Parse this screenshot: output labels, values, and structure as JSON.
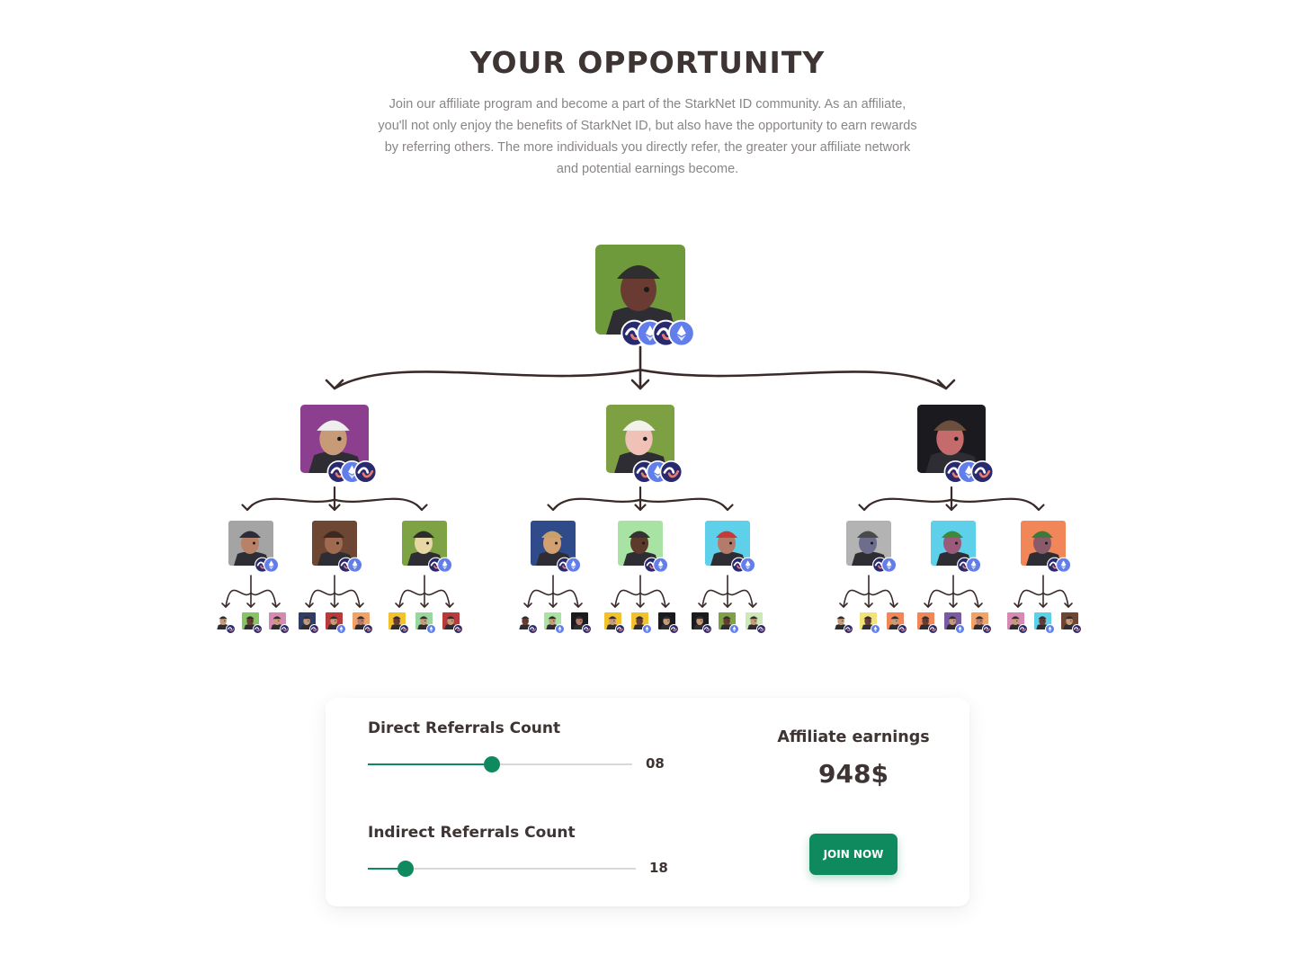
{
  "header": {
    "title": "YOUR OPPORTUNITY",
    "description": "Join our affiliate program and become a part of the StarkNet ID community. As an affiliate, you'll not only enjoy the benefits of StarkNet ID, but also have the opportunity to earn rewards by referring others. The more individuals you directly refer, the greater your affiliate network and potential earnings become."
  },
  "tree": {
    "root": {
      "bg": "#6f9a3c",
      "skin": "#6a3b32",
      "hat": "#2f2f2f",
      "badges": [
        "starknet",
        "ethereum",
        "starknet",
        "ethereum"
      ]
    },
    "level1": [
      {
        "bg": "#8d3f8f",
        "skin": "#c79a78",
        "hat": "#eeeeee",
        "badges": [
          "starknet",
          "ethereum",
          "starknet"
        ]
      },
      {
        "bg": "#7da043",
        "skin": "#f0c1b7",
        "hat": "#f2f2ea",
        "badges": [
          "starknet",
          "ethereum",
          "starknet"
        ]
      },
      {
        "bg": "#1b1b1f",
        "skin": "#c66b6b",
        "hat": "#6b4e3d",
        "badges": [
          "starknet",
          "ethereum",
          "starknet"
        ]
      }
    ],
    "level2": [
      {
        "bg": "#a4a4a4",
        "skin": "#b88269",
        "hat": "#2c2c3a",
        "badges": [
          "starknet",
          "ethereum"
        ]
      },
      {
        "bg": "#6e4634",
        "skin": "#a06a50",
        "hat": "#3a2a22",
        "badges": [
          "starknet",
          "ethereum"
        ]
      },
      {
        "bg": "#7ea344",
        "skin": "#e8d7a5",
        "hat": "#2d2d2d",
        "badges": [
          "starknet",
          "ethereum"
        ]
      },
      {
        "bg": "#2f4b8a",
        "skin": "#d3a072",
        "hat": "#c7a16a",
        "badges": [
          "starknet",
          "ethereum"
        ]
      },
      {
        "bg": "#a8e3a3",
        "skin": "#5d3a2c",
        "hat": "#333333",
        "badges": [
          "starknet",
          "ethereum"
        ]
      },
      {
        "bg": "#5fd0ea",
        "skin": "#b57b6a",
        "hat": "#c63a3a",
        "badges": [
          "starknet",
          "ethereum"
        ]
      },
      {
        "bg": "#b3b3b3",
        "skin": "#6d6d8d",
        "hat": "#4a4a4a",
        "badges": [
          "starknet",
          "ethereum"
        ]
      },
      {
        "bg": "#5fd0ea",
        "skin": "#9b5a7a",
        "hat": "#3d8a3a",
        "badges": [
          "starknet",
          "ethereum"
        ]
      },
      {
        "bg": "#f18758",
        "skin": "#8a5a6a",
        "hat": "#3d7a3a",
        "badges": [
          "starknet",
          "ethereum"
        ]
      }
    ],
    "level3": [
      {
        "bg": "#ffffff",
        "skin": "#c79a78",
        "hat": "#2f2f2f",
        "badges": [
          "starknet"
        ]
      },
      {
        "bg": "#87c464",
        "skin": "#6a3b32",
        "hat": "#2f2f2f",
        "badges": [
          "starknet"
        ]
      },
      {
        "bg": "#d889b3",
        "skin": "#c79a78",
        "hat": "#2f2f2f",
        "badges": [
          "starknet"
        ]
      },
      {
        "bg": "#2f3d66",
        "skin": "#c79a78",
        "hat": "#2f2f2f",
        "badges": [
          "starknet"
        ]
      },
      {
        "bg": "#b83a3a",
        "skin": "#c79a78",
        "hat": "#2f2f2f",
        "badges": [
          "ethereum"
        ]
      },
      {
        "bg": "#f0a268",
        "skin": "#b57b6a",
        "hat": "#2f2f2f",
        "badges": [
          "starknet"
        ]
      },
      {
        "bg": "#f2c12e",
        "skin": "#6a3b32",
        "hat": "#2f2f2f",
        "badges": [
          "starknet"
        ]
      },
      {
        "bg": "#9ad69f",
        "skin": "#c79a78",
        "hat": "#2f2f2f",
        "badges": [
          "ethereum"
        ]
      },
      {
        "bg": "#b83a3a",
        "skin": "#c79a78",
        "hat": "#2f2f2f",
        "badges": [
          "starknet"
        ]
      },
      {
        "bg": "#ffffff",
        "skin": "#6a3b32",
        "hat": "#2f2f2f",
        "badges": [
          "starknet"
        ]
      },
      {
        "bg": "#a8e3a3",
        "skin": "#c79a78",
        "hat": "#2f2f2f",
        "badges": [
          "ethereum"
        ]
      },
      {
        "bg": "#1b1b1f",
        "skin": "#b57b6a",
        "hat": "#2f2f2f",
        "badges": [
          "starknet"
        ]
      },
      {
        "bg": "#f2c12e",
        "skin": "#c79a78",
        "hat": "#2f2f2f",
        "badges": [
          "starknet"
        ]
      },
      {
        "bg": "#f2c12e",
        "skin": "#6a3b32",
        "hat": "#2f2f2f",
        "badges": [
          "ethereum"
        ]
      },
      {
        "bg": "#1b1b1f",
        "skin": "#c79a78",
        "hat": "#2f2f2f",
        "badges": [
          "starknet"
        ]
      },
      {
        "bg": "#1b1b1f",
        "skin": "#c79a78",
        "hat": "#2f2f2f",
        "badges": [
          "starknet"
        ]
      },
      {
        "bg": "#7ea344",
        "skin": "#6a3b32",
        "hat": "#2f2f2f",
        "badges": [
          "ethereum"
        ]
      },
      {
        "bg": "#cfe8b8",
        "skin": "#c79a78",
        "hat": "#2f2f2f",
        "badges": [
          "starknet"
        ]
      },
      {
        "bg": "#ffffff",
        "skin": "#c79a78",
        "hat": "#2f2f2f",
        "badges": [
          "starknet"
        ]
      },
      {
        "bg": "#f2e27a",
        "skin": "#6a3b32",
        "hat": "#2f2f2f",
        "badges": [
          "ethereum"
        ]
      },
      {
        "bg": "#f18758",
        "skin": "#c79a78",
        "hat": "#2f2f2f",
        "badges": [
          "starknet"
        ]
      },
      {
        "bg": "#f18758",
        "skin": "#6a3b32",
        "hat": "#2f2f2f",
        "badges": [
          "starknet"
        ]
      },
      {
        "bg": "#7a5aa3",
        "skin": "#c79a78",
        "hat": "#2f2f2f",
        "badges": [
          "ethereum"
        ]
      },
      {
        "bg": "#f0a268",
        "skin": "#b57b6a",
        "hat": "#2f2f2f",
        "badges": [
          "starknet"
        ]
      },
      {
        "bg": "#d889b3",
        "skin": "#c79a78",
        "hat": "#2f2f2f",
        "badges": [
          "starknet"
        ]
      },
      {
        "bg": "#5fd0ea",
        "skin": "#6a3b32",
        "hat": "#2f2f2f",
        "badges": [
          "ethereum"
        ]
      },
      {
        "bg": "#6e4634",
        "skin": "#c79a78",
        "hat": "#2f2f2f",
        "badges": [
          "starknet"
        ]
      }
    ],
    "colors": {
      "arrow": "#3b2a2a",
      "starknet": "#29296e",
      "starknet_red": "#ec796b",
      "ethereum": "#627eea"
    }
  },
  "calculator": {
    "direct": {
      "label": "Direct Referrals Count",
      "value": "08",
      "fraction": 0.47
    },
    "indirect": {
      "label": "Indirect Referrals Count",
      "value": "18",
      "fraction": 0.14
    },
    "earnings_label": "Affiliate earnings",
    "earnings_value": "948$",
    "join_label": "JOIN NOW",
    "accent": "#0f8a5f"
  }
}
